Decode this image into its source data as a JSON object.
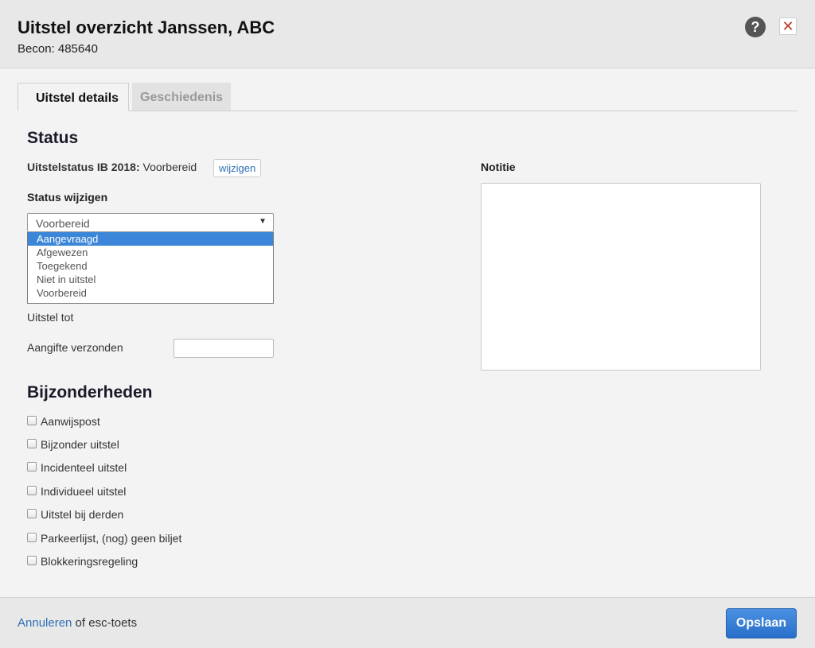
{
  "header": {
    "title": "Uitstel overzicht Janssen, ABC",
    "subtitle": "Becon: 485640",
    "help_glyph": "?",
    "close_glyph": "✕"
  },
  "tabs": [
    {
      "label": "Uitstel details",
      "active": true
    },
    {
      "label": "Geschiedenis",
      "active": false
    }
  ],
  "status": {
    "heading": "Status",
    "label": "Uitstelstatus IB 2018:",
    "value": "Voorbereid",
    "change_button": "wijzigen",
    "change_label": "Status wijzigen",
    "select_value": "Voorbereid",
    "options": [
      "Aangevraagd",
      "Afgewezen",
      "Toegekend",
      "Niet in uitstel",
      "Voorbereid"
    ],
    "highlighted_option": "Aangevraagd",
    "uitstel_tot_label": "Uitstel tot",
    "aangifte_label": "Aangifte verzonden",
    "aangifte_value": ""
  },
  "notitie": {
    "label": "Notitie",
    "value": ""
  },
  "bijzonderheden": {
    "heading": "Bijzonderheden",
    "items": [
      {
        "label": "Aanwijspost",
        "checked": false
      },
      {
        "label": "Bijzonder uitstel",
        "checked": false
      },
      {
        "label": "Incidenteel uitstel",
        "checked": false
      },
      {
        "label": "Individueel uitstel",
        "checked": false
      },
      {
        "label": "Uitstel bij derden",
        "checked": false
      },
      {
        "label": "Parkeerlijst, (nog) geen biljet",
        "checked": false
      },
      {
        "label": "Blokkeringsregeling",
        "checked": false
      }
    ]
  },
  "footer": {
    "cancel_link": "Annuleren",
    "cancel_suffix": " of esc-toets",
    "save_button": "Opslaan"
  },
  "colors": {
    "accent": "#3b86d8",
    "link": "#2f6fb5",
    "close": "#c0392b"
  }
}
